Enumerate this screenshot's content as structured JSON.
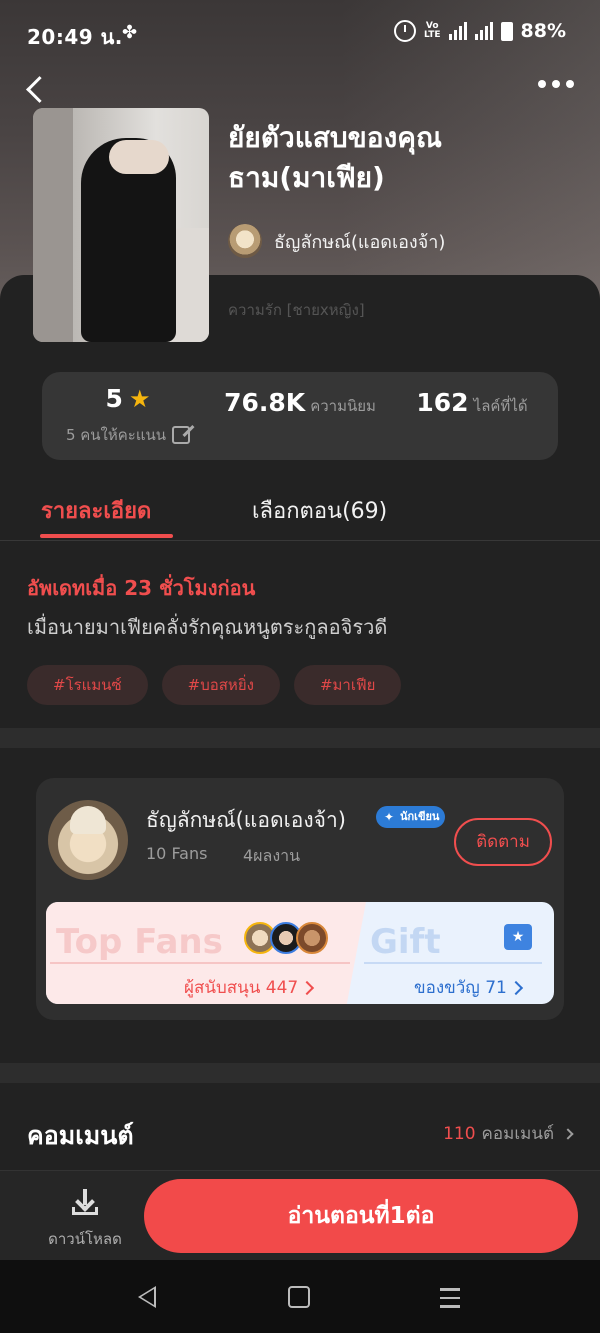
{
  "status_bar": {
    "time": "20:49 น.",
    "volte_top": "Vo",
    "volte_bottom": "LTE",
    "battery": "88%"
  },
  "book": {
    "title": "ยัยตัวแสบของคุณธาม(มาเฟีย)",
    "author": "ธัญลักษณ์(แอดเองจ้า)",
    "genre": "ความรัก [ชายxหญิง]"
  },
  "stats": {
    "rating_value": "5",
    "rating_label": "5 คนให้คะแนน",
    "popularity_value": "76.8K",
    "popularity_label": "ความนิยม",
    "likes_value": "162",
    "likes_label": "ไลค์ที่ได้"
  },
  "tabs": {
    "details": "รายละเอียด",
    "chapters": "เลือกตอน(69)"
  },
  "details": {
    "updated": "อัพเดทเมื่อ 23 ชั่วโมงก่อน",
    "synopsis": "เมื่อนายมาเฟียคลั่งรักคุณหนูตระกูลอจิรวดี",
    "tags": [
      "#โรแมนซ์",
      "#บอสหยิ่ง",
      "#มาเฟีย"
    ]
  },
  "author_card": {
    "name": "ธัญลักษณ์(แอดเองจ้า)",
    "badge": "นักเขียน",
    "fans": "10 Fans",
    "works": "4ผลงาน",
    "follow_label": "ติดตาม",
    "top_fans_title": "Top Fans",
    "supporters": "ผู้สนับสนุน 447",
    "gift_title": "Gift",
    "gifts": "ของขวัญ 71"
  },
  "comments": {
    "title": "คอมเมนต์",
    "count": "110",
    "count_label": "คอมเมนต์"
  },
  "bottom_bar": {
    "download_label": "ดาวน์โหลด",
    "read_label": "อ่านตอนที่1ต่อ"
  },
  "colors": {
    "accent": "#f04e4e",
    "background": "#222222",
    "star": "#f5b50e",
    "badge_blue": "#2c7bd6"
  },
  "icons": [
    "back-icon",
    "more-icon",
    "star-icon",
    "edit-icon",
    "writer-badge-icon",
    "gift-icon",
    "download-icon"
  ]
}
